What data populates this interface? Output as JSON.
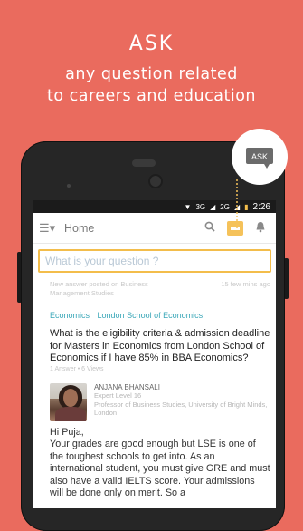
{
  "promo": {
    "title": "ASK",
    "subtitle_line1": "any question related",
    "subtitle_line2": "to careers and education"
  },
  "callout": {
    "label": "ASK"
  },
  "status_bar": {
    "time": "2:26",
    "signal": "3G",
    "signal2": "2G"
  },
  "app_bar": {
    "home_label": "Home",
    "icons": [
      "menu-icon",
      "search-icon",
      "chat-icon",
      "bell-icon"
    ]
  },
  "search": {
    "placeholder": "What is your question ?"
  },
  "feed_item": {
    "activity": "New answer posted on Business Management Studies",
    "time_ago": "15 few mins ago",
    "tags": [
      "Economics",
      "London School of Economics"
    ],
    "question": "What is the eligibility criteria & admission deadline for Masters in Economics from London School of Economics if I have 85% in BBA Economics?",
    "stats": "1 Answer • 6 Views",
    "answer": {
      "name": "ANJANA BHANSALI",
      "level": "Expert Level 16",
      "designation": "Professor of Business Studies, University of Bright Minds, London",
      "greeting": "Hi Puja,",
      "text": "Your grades are good enough but LSE is one of the toughest schools to get into. As an international student, you must give GRE and must also have a valid IELTS score. Your admissions will be done only on merit. So a"
    }
  },
  "colors": {
    "background": "#ea6b5e",
    "accent": "#f3bd4b",
    "tag": "#3aa7b8"
  }
}
